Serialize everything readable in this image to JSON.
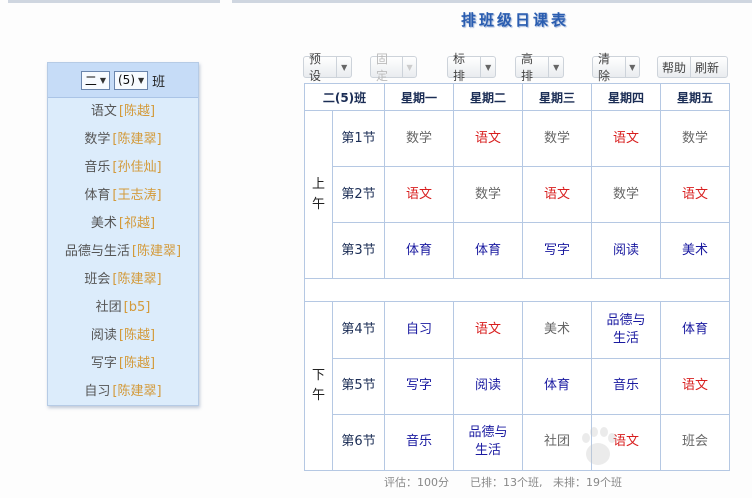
{
  "title": "排班级日课表",
  "left_panel": {
    "grade": "二",
    "class_no": "(5)",
    "class_suffix": "班",
    "subjects": [
      {
        "name": "语文",
        "teacher": "[陈越]"
      },
      {
        "name": "数学",
        "teacher": "[陈建翠]"
      },
      {
        "name": "音乐",
        "teacher": "[孙佳灿]"
      },
      {
        "name": "体育",
        "teacher": "[王志涛]"
      },
      {
        "name": "美术",
        "teacher": "[祁越]"
      },
      {
        "name": "品德与生活",
        "teacher": "[陈建翠]"
      },
      {
        "name": "班会",
        "teacher": "[陈建翠]"
      },
      {
        "name": "社团",
        "teacher": "[b5]"
      },
      {
        "name": "阅读",
        "teacher": "[陈越]"
      },
      {
        "name": "写字",
        "teacher": "[陈越]"
      },
      {
        "name": "自习",
        "teacher": "[陈建翠]"
      }
    ]
  },
  "toolbar": {
    "preset": "预设",
    "fixed": "固定",
    "mark": "标排",
    "advanced": "高排",
    "clear": "清除",
    "help": "帮助",
    "refresh": "刷新"
  },
  "timetable": {
    "corner": "二(5)班",
    "days": [
      "星期一",
      "星期二",
      "星期三",
      "星期四",
      "星期五"
    ],
    "morning": [
      "上",
      "午"
    ],
    "afternoon": [
      "下",
      "午"
    ],
    "periods": [
      {
        "label": "第1节",
        "cells": [
          {
            "text": "数学",
            "color": "gray"
          },
          {
            "text": "语文",
            "color": "red"
          },
          {
            "text": "数学",
            "color": "gray"
          },
          {
            "text": "语文",
            "color": "red"
          },
          {
            "text": "数学",
            "color": "gray"
          }
        ]
      },
      {
        "label": "第2节",
        "cells": [
          {
            "text": "语文",
            "color": "red"
          },
          {
            "text": "数学",
            "color": "gray"
          },
          {
            "text": "语文",
            "color": "red"
          },
          {
            "text": "数学",
            "color": "gray"
          },
          {
            "text": "语文",
            "color": "red"
          }
        ]
      },
      {
        "label": "第3节",
        "cells": [
          {
            "text": "体育",
            "color": "blue"
          },
          {
            "text": "体育",
            "color": "blue"
          },
          {
            "text": "写字",
            "color": "blue"
          },
          {
            "text": "阅读",
            "color": "blue"
          },
          {
            "text": "美术",
            "color": "blue"
          }
        ]
      },
      {
        "label": "第4节",
        "cells": [
          {
            "text": "自习",
            "color": "blue"
          },
          {
            "text": "语文",
            "color": "red"
          },
          {
            "text": "美术",
            "color": "gray"
          },
          {
            "text": "品德与生活",
            "color": "blue"
          },
          {
            "text": "体育",
            "color": "blue"
          }
        ]
      },
      {
        "label": "第5节",
        "cells": [
          {
            "text": "写字",
            "color": "blue"
          },
          {
            "text": "阅读",
            "color": "blue"
          },
          {
            "text": "体育",
            "color": "blue"
          },
          {
            "text": "音乐",
            "color": "blue"
          },
          {
            "text": "语文",
            "color": "red"
          }
        ]
      },
      {
        "label": "第6节",
        "cells": [
          {
            "text": "音乐",
            "color": "blue"
          },
          {
            "text": "品德与生活",
            "color": "blue"
          },
          {
            "text": "社团",
            "color": "gray"
          },
          {
            "text": "语文",
            "color": "red"
          },
          {
            "text": "班会",
            "color": "gray"
          }
        ]
      }
    ]
  },
  "footer": {
    "score": "评估：100分",
    "scheduled": "已排：13个班,",
    "unscheduled": "未排：19个班"
  },
  "colors": {
    "red": "#d81e1e",
    "blue": "#1a1aa0",
    "gray": "#666666",
    "teacher": "#d39a3a"
  }
}
